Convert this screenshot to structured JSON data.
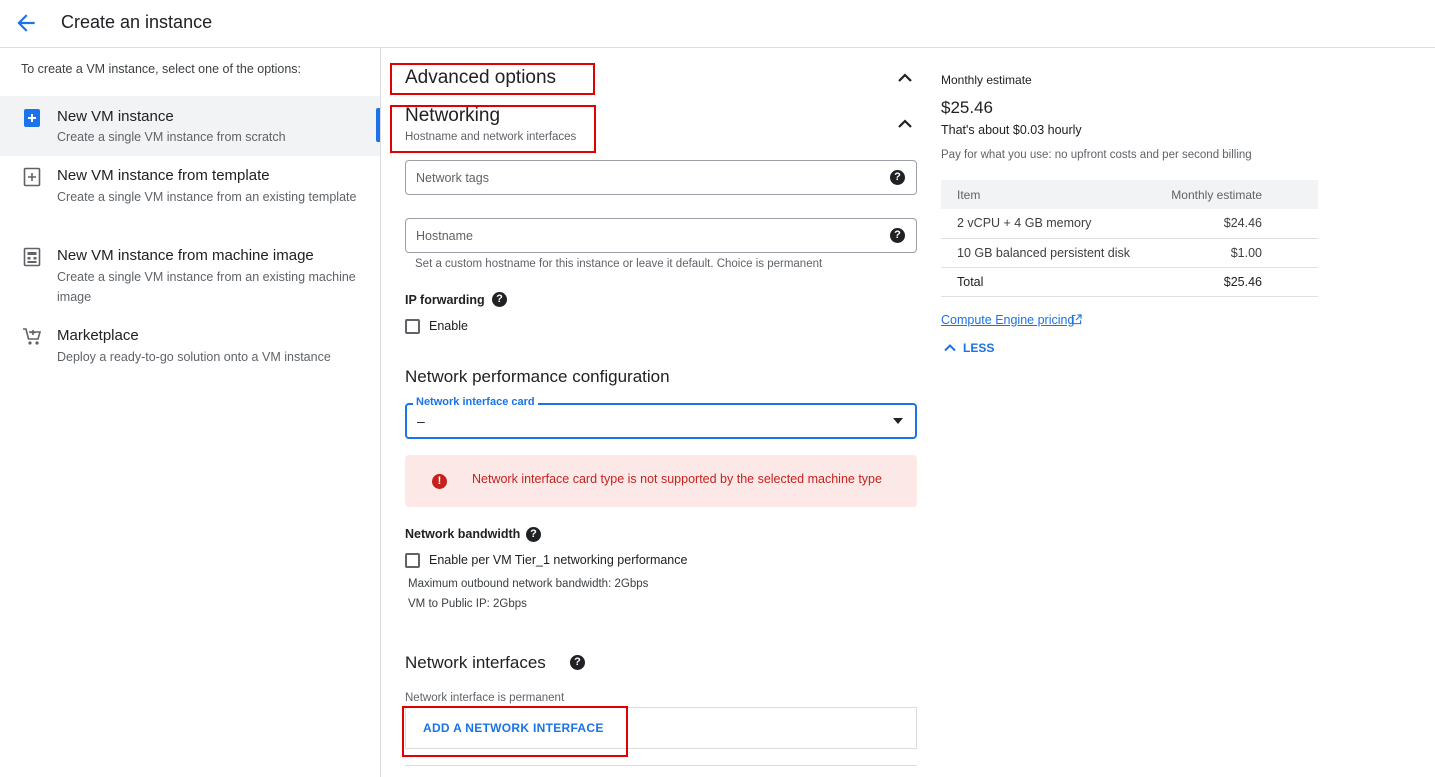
{
  "header": {
    "title": "Create an instance"
  },
  "left": {
    "intro": "To create a VM instance, select one of the options:",
    "options": [
      {
        "title": "New VM instance",
        "desc": "Create a single VM instance from scratch"
      },
      {
        "title": "New VM instance from template",
        "desc": "Create a single VM instance from an existing template"
      },
      {
        "title": "New VM instance from machine image",
        "desc": "Create a single VM instance from an existing machine image"
      },
      {
        "title": "Marketplace",
        "desc": "Deploy a ready-to-go solution onto a VM instance"
      }
    ]
  },
  "main": {
    "advanced_title": "Advanced options",
    "networking_title": "Networking",
    "networking_subtitle": "Hostname and network interfaces",
    "network_tags_placeholder": "Network tags",
    "hostname_placeholder": "Hostname",
    "hostname_hint": "Set a custom hostname for this instance or leave it default. Choice is permanent",
    "ip_forwarding_label": "IP forwarding",
    "ip_forwarding_checkbox": "Enable",
    "perf_title": "Network performance configuration",
    "nic_label": "Network interface card",
    "nic_value": "–",
    "error_text": "Network interface card type is not supported by the selected machine type",
    "bandwidth_label": "Network bandwidth",
    "bandwidth_checkbox": "Enable per VM Tier_1 networking performance",
    "max_outbound": "Maximum outbound network bandwidth: 2Gbps",
    "vm_to_public": "VM to Public IP: 2Gbps",
    "interfaces_title": "Network interfaces",
    "interfaces_note": "Network interface is permanent",
    "add_interface_button": "ADD A NETWORK INTERFACE"
  },
  "estimate": {
    "title": "Monthly estimate",
    "price": "$25.46",
    "hourly": "That's about $0.03 hourly",
    "payg": "Pay for what you use: no upfront costs and per second billing",
    "col_item": "Item",
    "col_estimate": "Monthly estimate",
    "rows": [
      {
        "item": "2 vCPU + 4 GB memory",
        "value": "$24.46"
      },
      {
        "item": "10 GB balanced persistent disk",
        "value": "$1.00"
      }
    ],
    "total_label": "Total",
    "total_value": "$25.46",
    "pricing_link": "Compute Engine pricing",
    "less_label": "LESS"
  },
  "colors": {
    "accent": "#1a73e8",
    "error": "#c5221f",
    "error_bg": "#fce8e6",
    "highlight": "#e00000"
  }
}
